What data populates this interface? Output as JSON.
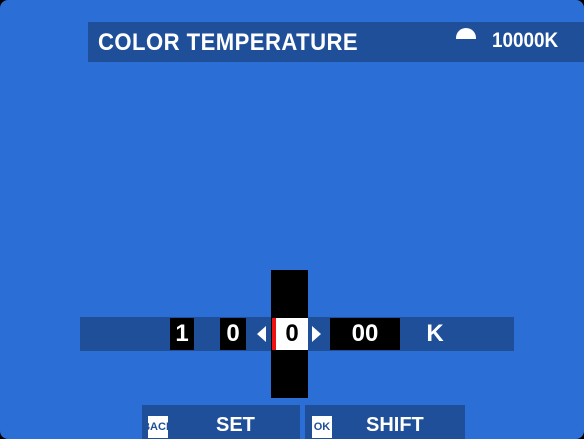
{
  "header": {
    "title": "COLOR TEMPERATURE",
    "wb_icon": "white-balance-icon",
    "value": "10000K"
  },
  "selector": {
    "digits": [
      "1",
      "0",
      "0",
      "00"
    ],
    "unit": "K",
    "active_index": 2
  },
  "footer": {
    "back_key": "BACK",
    "back_label": "SET",
    "ok_key": "OK",
    "ok_label": "SHIFT"
  },
  "colors": {
    "background": "#2b6fd6",
    "bar": "#1f4f99",
    "highlight": "#ffffff",
    "accent_red": "#e11111"
  }
}
